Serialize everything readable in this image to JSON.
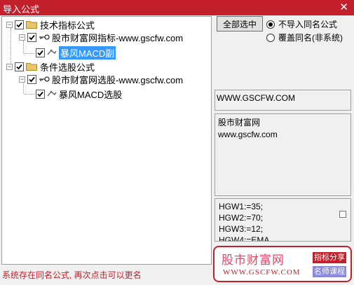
{
  "window": {
    "title": "导入公式",
    "close_glyph": "✕"
  },
  "tree": {
    "nodes": [
      {
        "label": "技术指标公式",
        "checked": true,
        "expanded": true
      },
      {
        "label": "股市财富网指标-www.gscfw.com",
        "checked": true,
        "expanded": true
      },
      {
        "label": "暴风MACD副",
        "checked": true,
        "selected": true
      },
      {
        "label": "条件选股公式",
        "checked": true,
        "expanded": true
      },
      {
        "label": "股市财富网选股-www.gscfw.com",
        "checked": true,
        "expanded": true
      },
      {
        "label": "暴风MACD选股",
        "checked": true
      }
    ]
  },
  "actions": {
    "select_all_label": "全部选中"
  },
  "options": [
    {
      "label": "不导入同名公式",
      "selected": true
    },
    {
      "label": "覆盖同名(非系统)",
      "selected": false
    }
  ],
  "info": {
    "url": "WWW.GSCFW.COM",
    "desc_line1": "股市财富网",
    "desc_line2": "www.gscfw.com",
    "code": [
      "HGW1:=35;",
      "HGW2:=70;",
      "HGW3:=12;",
      "HGW4:=EMA"
    ]
  },
  "watermark": {
    "name": "股市财富网",
    "url": "WWW.GSCFW.COM",
    "tag1": "指标分享",
    "tag2": "名师课程"
  },
  "status": {
    "message": "系统存在同名公式, 再次点击可以更名"
  },
  "colors": {
    "title_bar": "#c4202c",
    "selection": "#3399ff",
    "status_text": "#c4202c"
  }
}
